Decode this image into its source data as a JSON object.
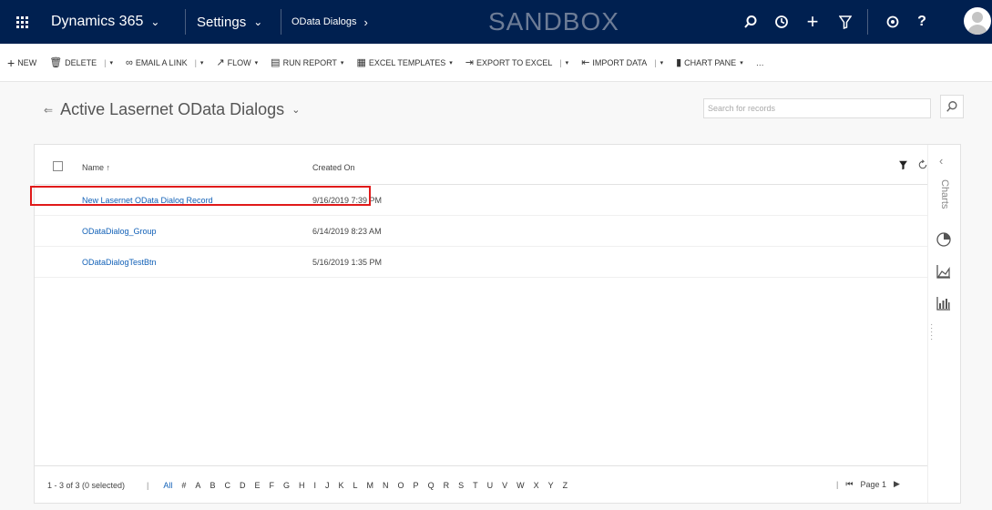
{
  "nav": {
    "app_name": "Dynamics 365",
    "area": "Settings",
    "breadcrumb": "OData Dialogs",
    "environment": "SANDBOX",
    "icons": [
      "search-icon",
      "recent-icon",
      "plus-icon",
      "filter-icon",
      "gear-icon",
      "help-icon"
    ]
  },
  "commands": {
    "new": "NEW",
    "delete": "DELETE",
    "email_link": "EMAIL A LINK",
    "flow": "FLOW",
    "run_report": "RUN REPORT",
    "excel_templates": "EXCEL TEMPLATES",
    "export_excel": "EXPORT TO EXCEL",
    "import_data": "IMPORT DATA",
    "chart_pane": "CHART PANE",
    "more": "…"
  },
  "view": {
    "title": "Active Lasernet OData Dialogs",
    "search_placeholder": "Search for records"
  },
  "grid": {
    "columns": {
      "name": "Name ↑",
      "created_on": "Created On"
    },
    "rows": [
      {
        "name": "New Lasernet OData Dialog Record",
        "created_on": "9/16/2019 7:39 PM"
      },
      {
        "name": "ODataDialog_Group",
        "created_on": "6/14/2019 8:23 AM"
      },
      {
        "name": "ODataDialogTestBtn",
        "created_on": "5/16/2019 1:35 PM"
      }
    ]
  },
  "charts_rail": {
    "label": "Charts"
  },
  "footer": {
    "count": "1 - 3 of 3 (0 selected)",
    "letters": [
      "All",
      "#",
      "A",
      "B",
      "C",
      "D",
      "E",
      "F",
      "G",
      "H",
      "I",
      "J",
      "K",
      "L",
      "M",
      "N",
      "O",
      "P",
      "Q",
      "R",
      "S",
      "T",
      "U",
      "V",
      "W",
      "X",
      "Y",
      "Z"
    ],
    "page": "Page 1"
  },
  "colors": {
    "nav_bg": "#002050",
    "link": "#1160b7",
    "highlight": "#e01a1a"
  }
}
